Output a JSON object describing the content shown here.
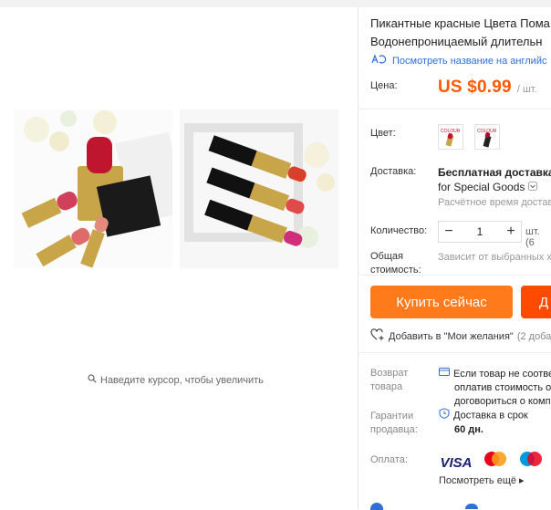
{
  "gallery": {
    "hover_hint": "Наведите курсор, чтобы увеличить"
  },
  "product": {
    "title_line1": "Пикантные красные Цвета Пома",
    "title_line2": "Водонепроницаемый длительн",
    "translate_link": "Посмотреть название на английс"
  },
  "price": {
    "label": "Цена:",
    "amount": "US $0.99",
    "unit": "/ шт."
  },
  "color": {
    "label": "Цвет:",
    "swatch_text": "COLOUR",
    "accent": "#c8102e"
  },
  "delivery": {
    "label": "Доставка:",
    "line1": "Бесплатная доставка в",
    "line2": "for Special Goods",
    "line3": "Расчётное время достав"
  },
  "quantity": {
    "label": "Количество:",
    "minus": "−",
    "value": "1",
    "plus": "+",
    "unit": "шт. (6"
  },
  "total": {
    "label_line1": "Общая",
    "label_line2": "стоимость:",
    "value": "Зависит от выбранных х"
  },
  "actions": {
    "buy_now": "Купить сейчас",
    "add_to_cart_partial": "Д",
    "wishlist": "Добавить в \"Мои желания\"",
    "wishlist_count": "(2 доба"
  },
  "returns": {
    "label_line1": "Возврат",
    "label_line2": "товара",
    "line1": "Если товар не соотве",
    "line2": "оплатив стоимость о",
    "line3": "договориться о комп"
  },
  "guarantee": {
    "label_line1": "Гарантии",
    "label_line2": "продавца:",
    "line1": "Доставка в срок",
    "line2": "60 дн."
  },
  "payment": {
    "label": "Оплата:",
    "visa": "VISA",
    "more": "Посмотреть ещё ▸"
  }
}
